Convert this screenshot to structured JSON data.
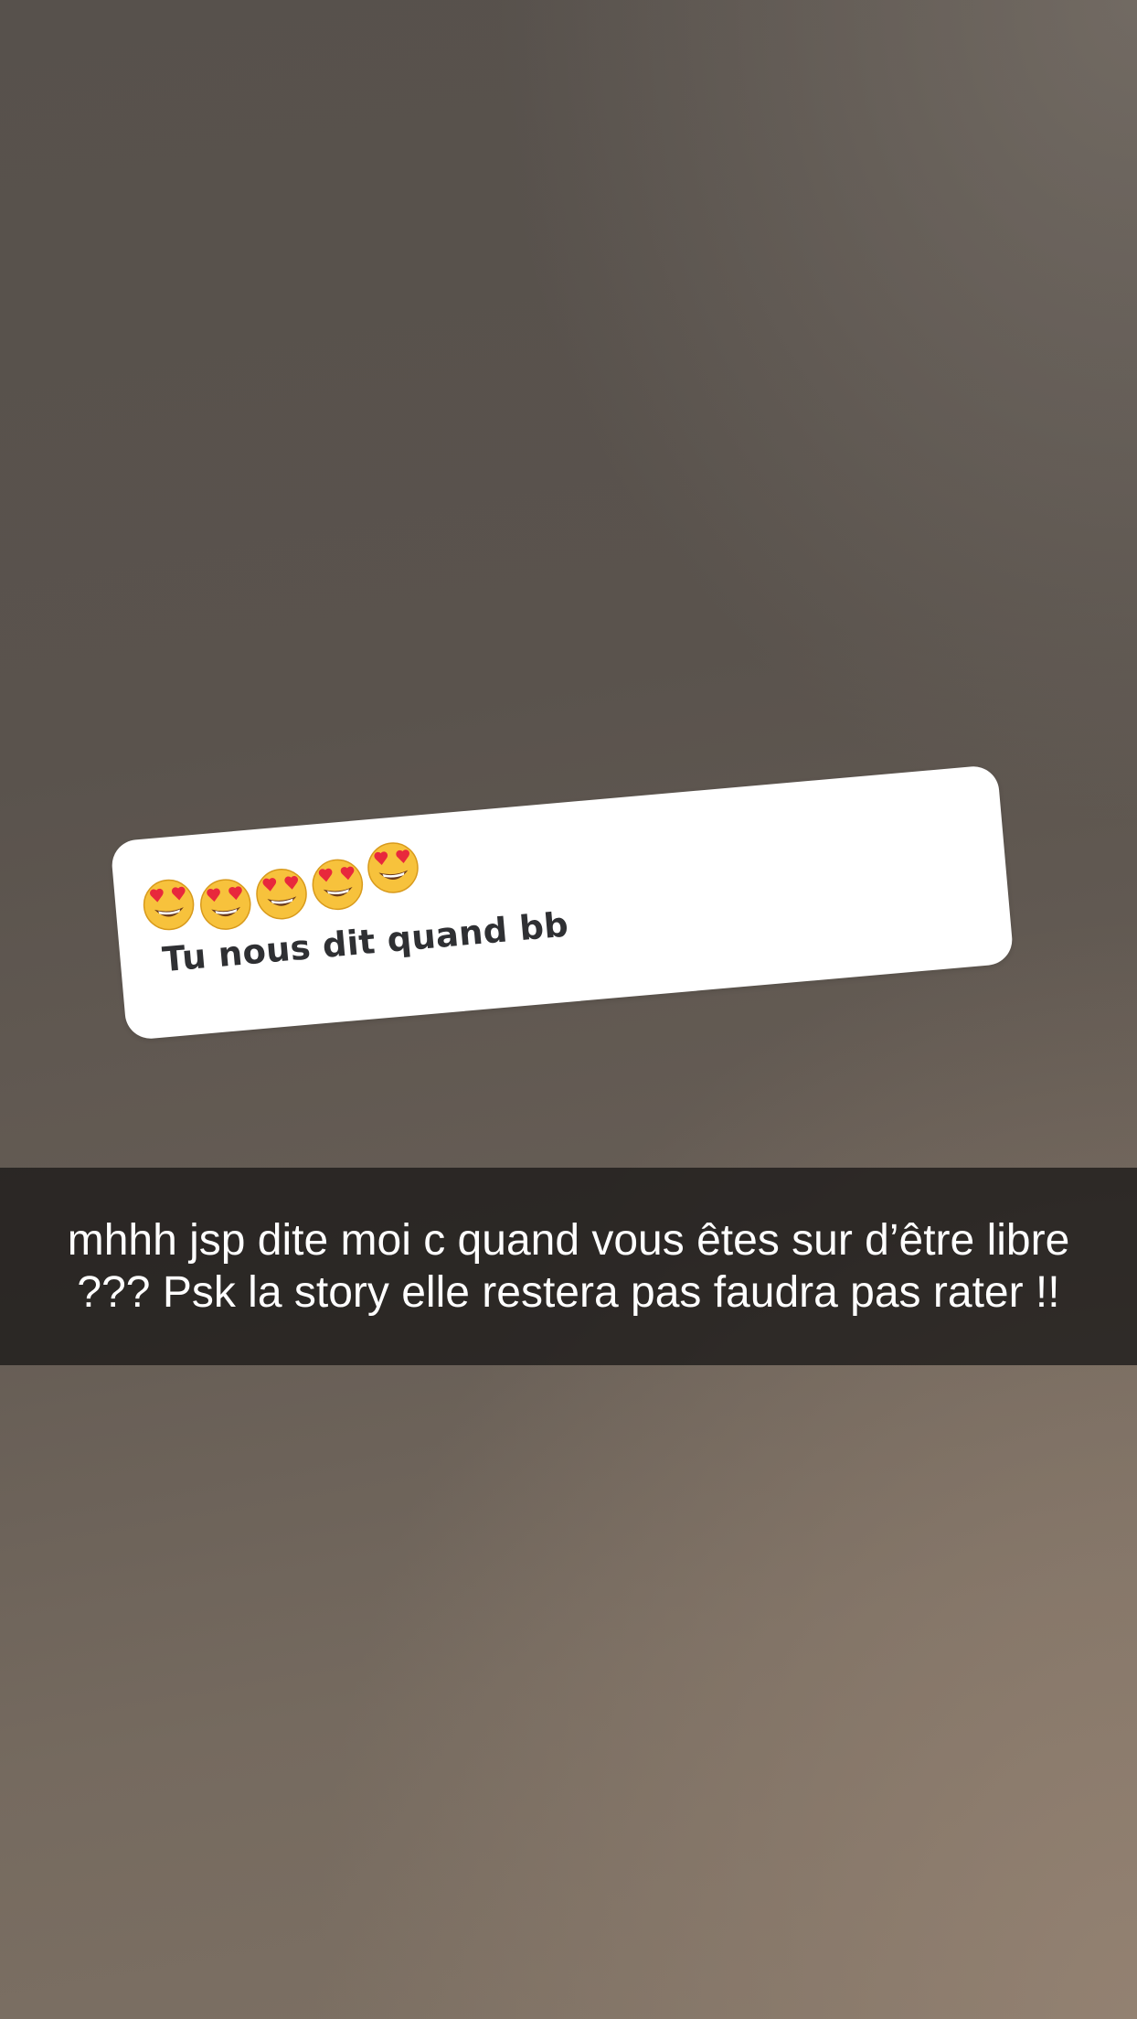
{
  "story": {
    "reply_sticker": {
      "emojis": [
        "heart-eyes-face",
        "heart-eyes-face",
        "heart-eyes-face",
        "heart-eyes-face",
        "heart-eyes-face"
      ],
      "text": "Tu nous dit quand bb"
    },
    "caption": {
      "text": "mhhh jsp dite moi c quand vous êtes sur d’être libre ??? Psk la story elle restera pas faudra pas rater !!"
    }
  },
  "colors": {
    "caption_bar": "#1e1c1b",
    "sticker_bg": "#ffffff",
    "sticker_text": "#2f3033",
    "emoji_face": "#f7c23c",
    "emoji_heart": "#e8283c"
  }
}
